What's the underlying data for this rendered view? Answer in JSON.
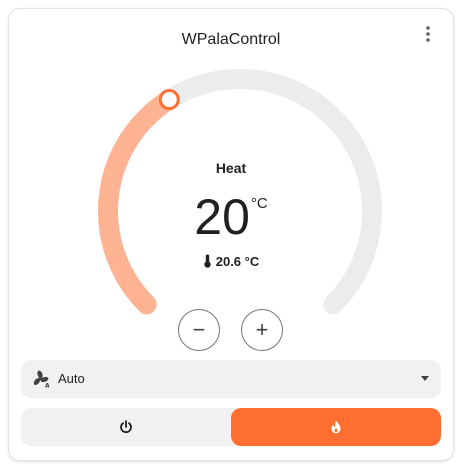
{
  "card": {
    "title": "WPalaControl",
    "menu_icon": "more-vert-icon"
  },
  "thermostat": {
    "mode_label": "Heat",
    "target_value": "20",
    "target_unit": "°C",
    "current_text": "20.6 °C",
    "current_icon": "thermometer-icon",
    "setpoint_fraction": 0.38,
    "colors": {
      "track": "#ececec",
      "heat_arc": "#ffb393",
      "handle": "#ff6f31",
      "active_mode": "#ff6f31"
    },
    "decrease_label": "−",
    "increase_label": "+"
  },
  "fan": {
    "icon": "fan-auto-icon",
    "value": "Auto"
  },
  "hvac_modes": [
    {
      "icon": "power-icon",
      "active": false
    },
    {
      "icon": "flame-icon",
      "active": true
    }
  ]
}
